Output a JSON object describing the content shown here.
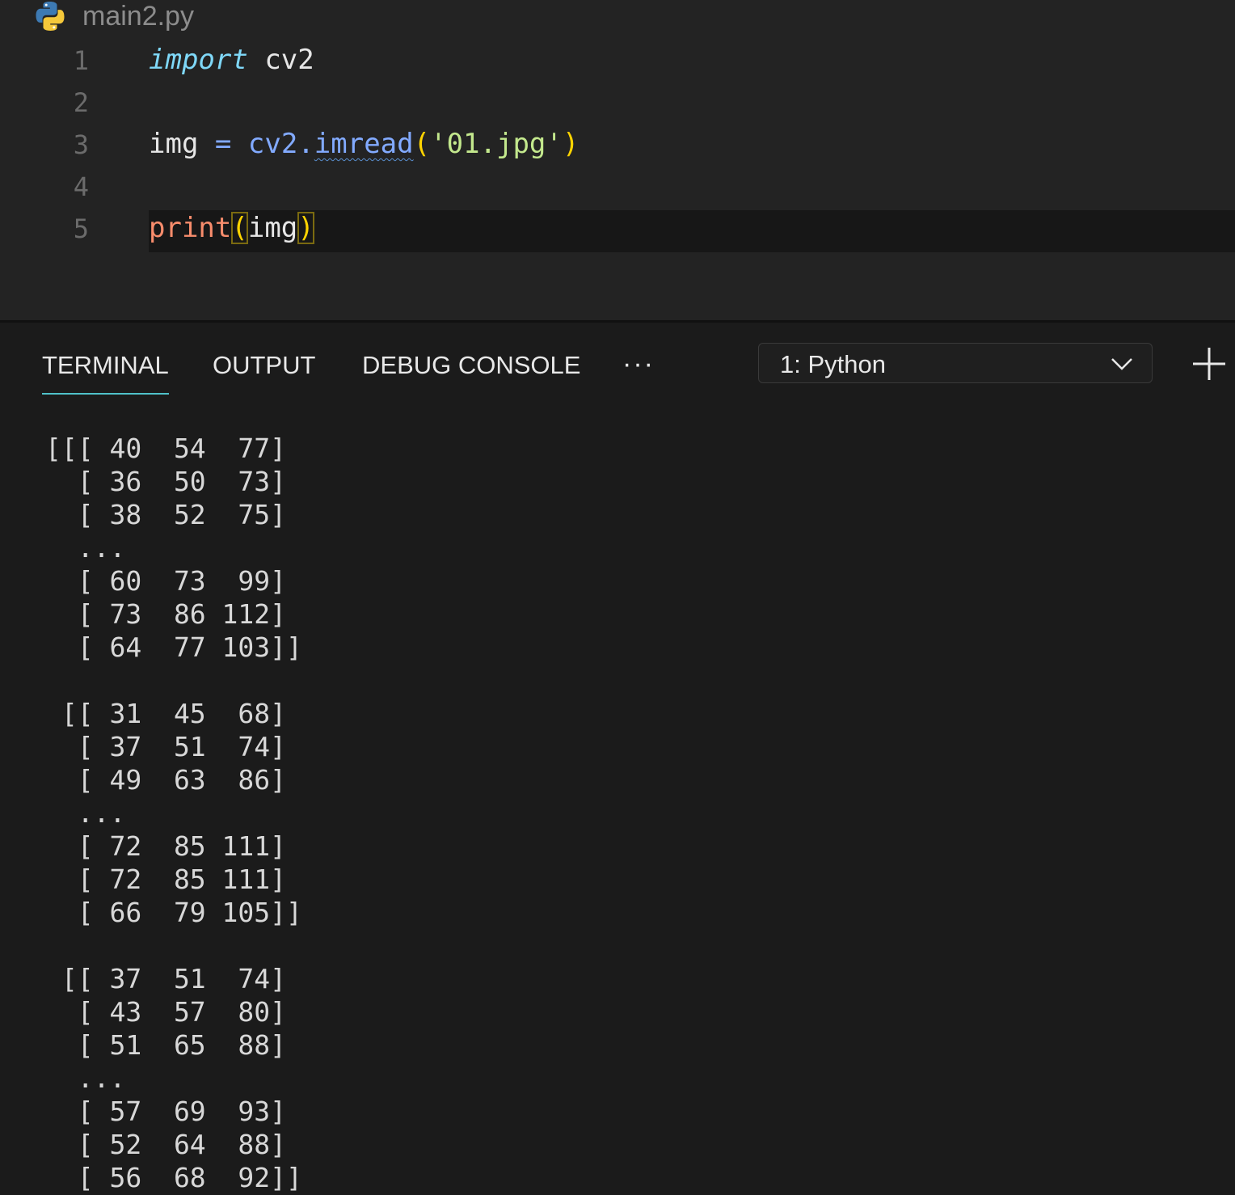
{
  "editor": {
    "filename": "main2.py",
    "line_numbers": [
      "1",
      "2",
      "3",
      "4",
      "5"
    ],
    "line1": {
      "keyword": "import",
      "module": "cv2"
    },
    "line3": {
      "var": "img",
      "op": "=",
      "module": "cv2",
      "dot": ".",
      "func": "imread",
      "open": "(",
      "string": "'01.jpg'",
      "close": ")"
    },
    "line5": {
      "builtin": "print",
      "open": "(",
      "arg": "img",
      "close": ")"
    }
  },
  "panel": {
    "tabs": [
      "TERMINAL",
      "OUTPUT",
      "DEBUG CONSOLE"
    ],
    "active_tab": "TERMINAL",
    "more_label": "···",
    "terminal_select": "1: Python",
    "icons": {
      "python": "python-file-icon",
      "dropdown": "chevron-down-icon",
      "new_terminal": "plus-icon"
    }
  },
  "terminal": {
    "lines": [
      "[[[ 40  54  77]",
      "  [ 36  50  73]",
      "  [ 38  52  75]",
      "  ...",
      "  [ 60  73  99]",
      "  [ 73  86 112]",
      "  [ 64  77 103]]",
      "",
      " [[ 31  45  68]",
      "  [ 37  51  74]",
      "  [ 49  63  86]",
      "  ...",
      "  [ 72  85 111]",
      "  [ 72  85 111]",
      "  [ 66  79 105]]",
      "",
      " [[ 37  51  74]",
      "  [ 43  57  80]",
      "  [ 51  65  88]",
      "  ...",
      "  [ 57  69  93]",
      "  [ 52  64  88]",
      "  [ 56  68  92]]"
    ]
  }
}
